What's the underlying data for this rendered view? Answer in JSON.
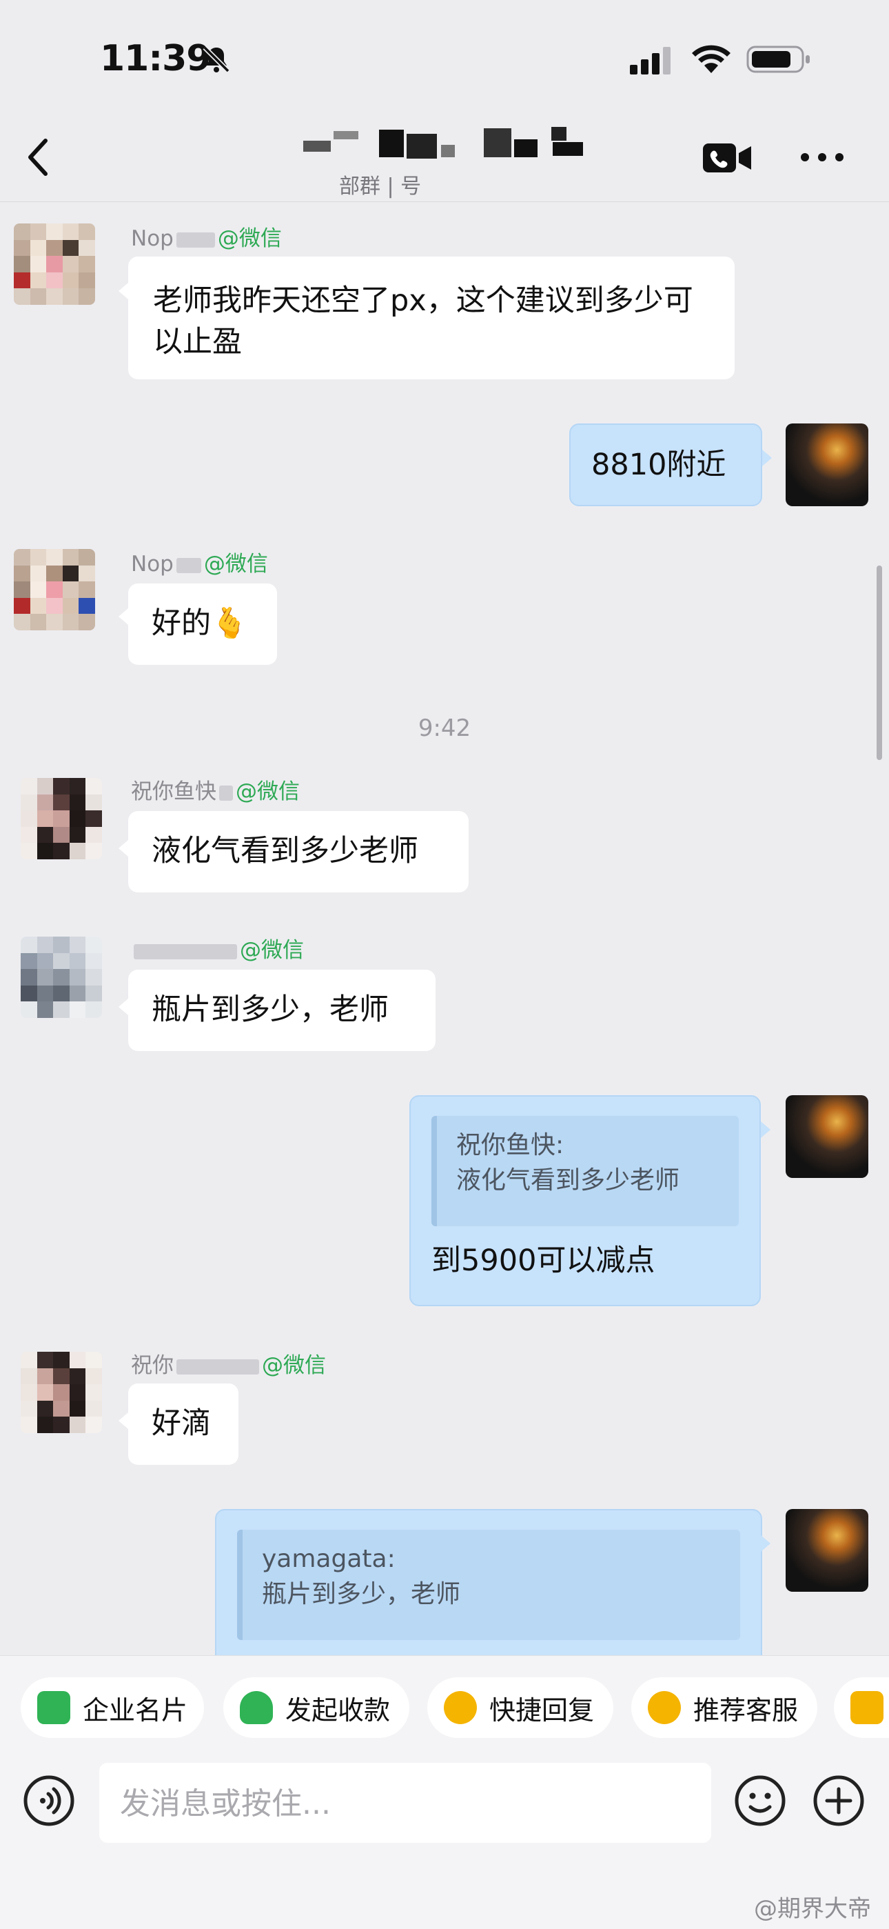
{
  "status_bar": {
    "time": "11:39"
  },
  "header": {
    "group_subtitle": "部群 | 号"
  },
  "chat": {
    "messages": [
      {
        "sender": "Nop",
        "tag": "@微信",
        "text": "老师我昨天还空了px，这个建议到多少可以止盈"
      },
      {
        "text": "8810附近"
      },
      {
        "sender": "Nop",
        "tag": "@微信",
        "text": "好的🫰"
      },
      {
        "sender": "祝你鱼快",
        "tag": "@微信",
        "text": "液化气看到多少老师"
      },
      {
        "tag": "@微信",
        "text": "瓶片到多少，老师"
      },
      {
        "quote_name": "祝你鱼快:",
        "quote_text": "液化气看到多少老师",
        "text": "到5900可以减点"
      },
      {
        "sender": "祝你",
        "tag": "@微信",
        "text": "好滴"
      },
      {
        "quote_name": "yamagata:",
        "quote_text": "瓶片到多少，老师"
      }
    ],
    "time_divider": "9:42"
  },
  "quick_actions": [
    {
      "label": "企业名片",
      "icon": "business-card-icon",
      "color": "#2fb355"
    },
    {
      "label": "发起收款",
      "icon": "payment-icon",
      "color": "#2fb355"
    },
    {
      "label": "快捷回复",
      "icon": "quick-reply-icon",
      "color": "#f5b400"
    },
    {
      "label": "推荐客服",
      "icon": "recommend-service-icon",
      "color": "#f5b400"
    }
  ],
  "input": {
    "placeholder": "发消息或按住..."
  },
  "watermark": "@期界大帝"
}
